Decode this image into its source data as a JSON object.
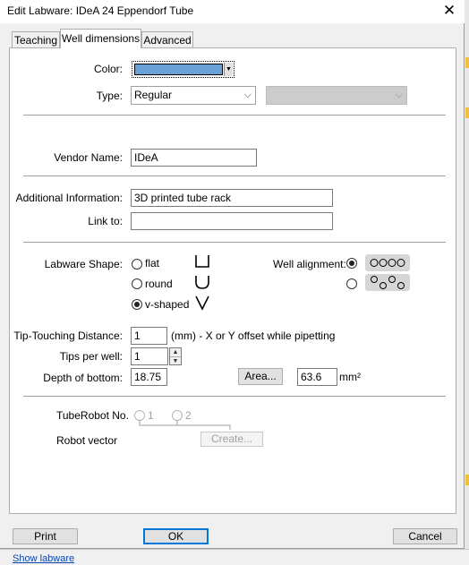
{
  "window": {
    "title": "Edit Labware: IDeA 24 Eppendorf Tube"
  },
  "tabs": [
    {
      "label": "Teaching",
      "active": false
    },
    {
      "label": "Well dimensions",
      "active": true
    },
    {
      "label": "Advanced",
      "active": false
    }
  ],
  "color": {
    "label": "Color:",
    "value_hex": "#6aa2d8"
  },
  "type": {
    "label": "Type:",
    "value": "Regular",
    "secondary_value": ""
  },
  "vendor": {
    "label": "Vendor Name:",
    "value": "IDeA"
  },
  "additional_info": {
    "label": "Additional Information:",
    "value": "3D printed tube rack"
  },
  "link": {
    "label": "Link to:",
    "value": ""
  },
  "labware_shape": {
    "label": "Labware Shape:",
    "options": [
      {
        "label": "flat",
        "checked": false,
        "icon": "flat-bottom-icon"
      },
      {
        "label": "round",
        "checked": false,
        "icon": "round-bottom-icon"
      },
      {
        "label": "v-shaped",
        "checked": true,
        "icon": "v-bottom-icon"
      }
    ]
  },
  "well_alignment": {
    "label": "Well alignment:",
    "options": [
      {
        "checked": true,
        "icon": "aligned-wells-icon"
      },
      {
        "checked": false,
        "icon": "staggered-wells-icon"
      }
    ]
  },
  "tip_touching": {
    "label": "Tip-Touching Distance:",
    "value": "1",
    "hint": "(mm) - X or Y offset while pipetting"
  },
  "tips_per_well": {
    "label": "Tips per well:",
    "value": "1"
  },
  "depth": {
    "label": "Depth of bottom:",
    "value": "18.75"
  },
  "area": {
    "button": "Area...",
    "value": "63.6",
    "unit": "mm²"
  },
  "tube_robot": {
    "label": "TubeRobot No.",
    "options": [
      "1",
      "2"
    ]
  },
  "robot_vector": {
    "label": "Robot vector",
    "button": "Create..."
  },
  "footer": {
    "print": "Print",
    "ok": "OK",
    "cancel": "Cancel"
  },
  "background": {
    "link_text": "Show labware"
  }
}
